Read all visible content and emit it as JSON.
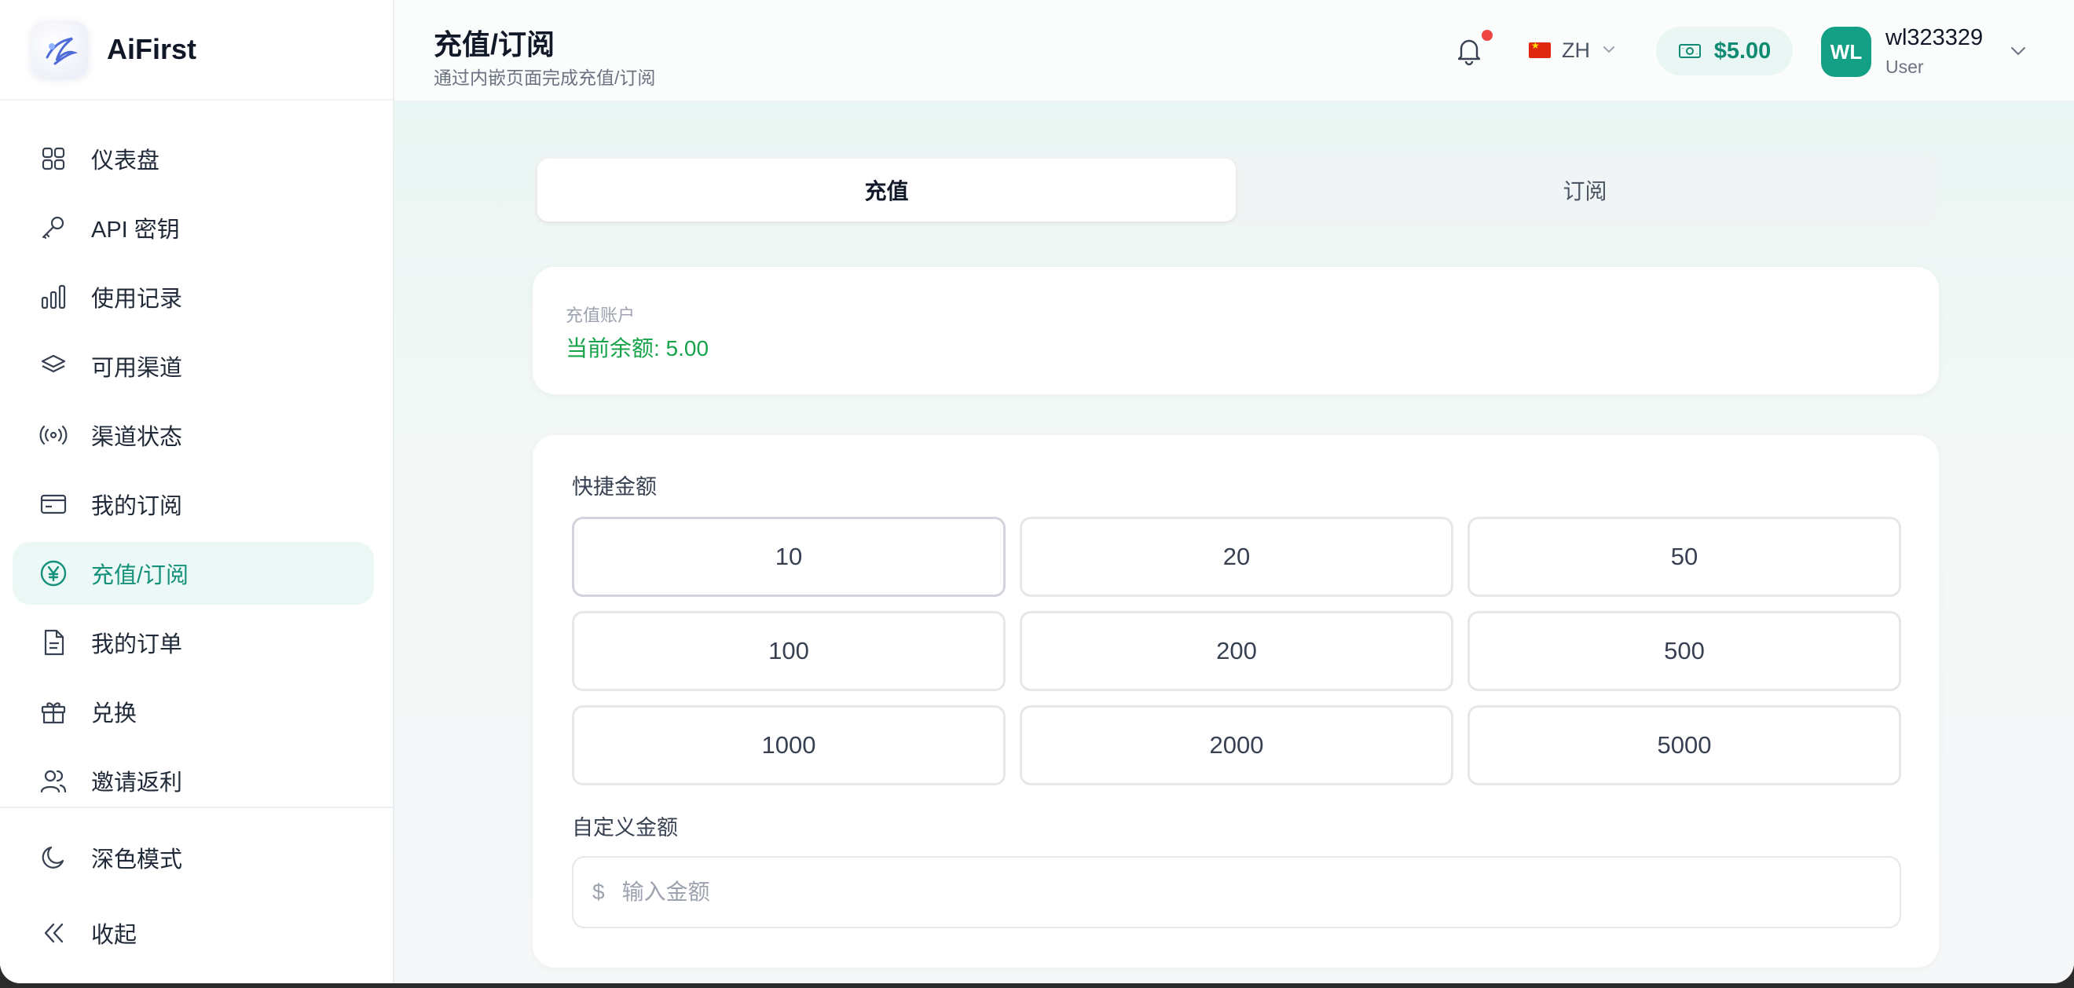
{
  "app": {
    "name": "AiFirst"
  },
  "sidebar": {
    "items": [
      {
        "label": "仪表盘",
        "icon": "grid-icon"
      },
      {
        "label": "API 密钥",
        "icon": "key-icon"
      },
      {
        "label": "使用记录",
        "icon": "bar-chart-icon"
      },
      {
        "label": "可用渠道",
        "icon": "layers-icon"
      },
      {
        "label": "渠道状态",
        "icon": "broadcast-icon"
      },
      {
        "label": "我的订阅",
        "icon": "card-icon"
      },
      {
        "label": "充值/订阅",
        "icon": "yen-icon",
        "active": true
      },
      {
        "label": "我的订单",
        "icon": "document-icon"
      },
      {
        "label": "兑换",
        "icon": "gift-icon"
      },
      {
        "label": "邀请返利",
        "icon": "users-icon"
      }
    ],
    "bottom": [
      {
        "label": "深色模式",
        "icon": "moon-icon"
      },
      {
        "label": "收起",
        "icon": "double-chevron-left-icon"
      }
    ]
  },
  "header": {
    "title": "充值/订阅",
    "subtitle": "通过内嵌页面完成充值/订阅",
    "language": "ZH",
    "balance": "$5.00",
    "user": {
      "initials": "WL",
      "name": "wl323329",
      "role": "User"
    }
  },
  "tabs": [
    {
      "label": "充值",
      "active": true
    },
    {
      "label": "订阅",
      "active": false
    }
  ],
  "account": {
    "label": "充值账户",
    "balance_text": "当前余额: 5.00"
  },
  "recharge": {
    "quick_label": "快捷金额",
    "amounts": [
      "10",
      "20",
      "50",
      "100",
      "200",
      "500",
      "1000",
      "2000",
      "5000"
    ],
    "custom_label": "自定义金额",
    "currency_symbol": "$",
    "custom_placeholder": "输入金额",
    "custom_value": ""
  },
  "colors": {
    "accent": "#14917a",
    "active_bg": "#ecf8f5",
    "balance_green": "#16a34a",
    "notification": "#ef4444"
  }
}
